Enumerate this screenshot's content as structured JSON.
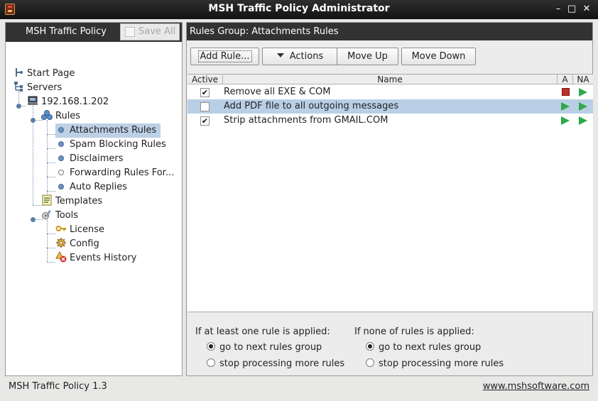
{
  "window": {
    "title": "MSH Traffic Policy Administrator"
  },
  "sidebar": {
    "title": "MSH Traffic Policy",
    "save_all_label": "Save All",
    "tree": {
      "start_page": "Start Page",
      "servers": "Servers",
      "server_ip": "192.168.1.202",
      "rules": "Rules",
      "rule_groups": [
        "Attachments Rules",
        "Spam Blocking Rules",
        "Disclaimers",
        "Forwarding Rules For...",
        "Auto Replies"
      ],
      "templates": "Templates",
      "tools": "Tools",
      "tool_items": [
        "License",
        "Config",
        "Events History"
      ]
    }
  },
  "main": {
    "header": "Rules Group: Attachments Rules",
    "toolbar": {
      "add_rule": "Add Rule...",
      "actions": "Actions",
      "move_up": "Move Up",
      "move_down": "Move Down"
    },
    "table": {
      "columns": [
        "Active",
        "Name",
        "A",
        "NA"
      ],
      "rows": [
        {
          "active": true,
          "name": "Remove all EXE & COM",
          "a": "stop",
          "na": "play"
        },
        {
          "active": false,
          "name": "Add PDF file to all outgoing messages",
          "a": "play",
          "na": "play"
        },
        {
          "active": true,
          "name": "Strip attachments from GMAIL.COM",
          "a": "play",
          "na": "play"
        }
      ]
    },
    "options": {
      "applied_label": "If at least one rule is applied:",
      "not_applied_label": "If none of rules is applied:",
      "next_group": "go to next rules group",
      "stop_processing": "stop processing more rules"
    }
  },
  "status": {
    "version": "MSH Traffic Policy 1.3",
    "website": "www.mshsoftware.com"
  },
  "colors": {
    "selection": "#bcd0e6",
    "header_dark": "#323232",
    "play_green": "#2fa84a",
    "stop_red": "#c0312b"
  }
}
